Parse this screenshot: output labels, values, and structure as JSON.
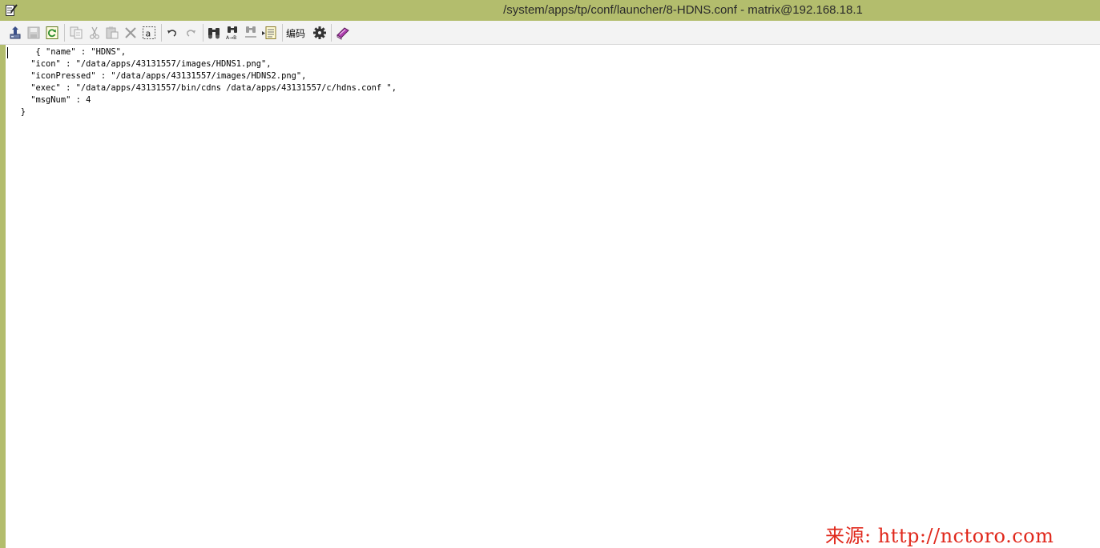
{
  "window": {
    "title": "/system/apps/tp/conf/launcher/8-HDNS.conf - matrix@192.168.18.1",
    "title_bar_color": "#b3bd6d"
  },
  "toolbar": {
    "buttons": [
      {
        "name": "upload-icon",
        "enabled": true
      },
      {
        "name": "save-icon",
        "enabled": false
      },
      {
        "name": "refresh-icon",
        "enabled": true
      },
      {
        "name": "copy-icon",
        "enabled": false
      },
      {
        "name": "cut-icon",
        "enabled": false
      },
      {
        "name": "paste-icon",
        "enabled": false
      },
      {
        "name": "delete-icon",
        "enabled": false
      },
      {
        "name": "select-all-icon",
        "enabled": true
      },
      {
        "name": "undo-icon",
        "enabled": true
      },
      {
        "name": "redo-icon",
        "enabled": false
      },
      {
        "name": "find-icon",
        "enabled": true
      },
      {
        "name": "find-replace-icon",
        "enabled": true
      },
      {
        "name": "find-next-icon",
        "enabled": false
      },
      {
        "name": "goto-line-icon",
        "enabled": true
      },
      {
        "name": "settings-gear-icon",
        "enabled": true
      },
      {
        "name": "help-book-icon",
        "enabled": true
      }
    ],
    "encoding_label": "编码"
  },
  "editor": {
    "lines": [
      "      { \"name\" : \"HDNS\",",
      "     \"icon\" : \"/data/apps/43131557/images/HDNS1.png\",",
      "     \"iconPressed\" : \"/data/apps/43131557/images/HDNS2.png\",",
      "     \"exec\" : \"/data/apps/43131557/bin/cdns /data/apps/43131557/c/hdns.conf \",",
      "     \"msgNum\" : 4",
      "   }"
    ]
  },
  "watermark": {
    "text": "来源: http://nctoro.com",
    "color": "#e0281c"
  }
}
